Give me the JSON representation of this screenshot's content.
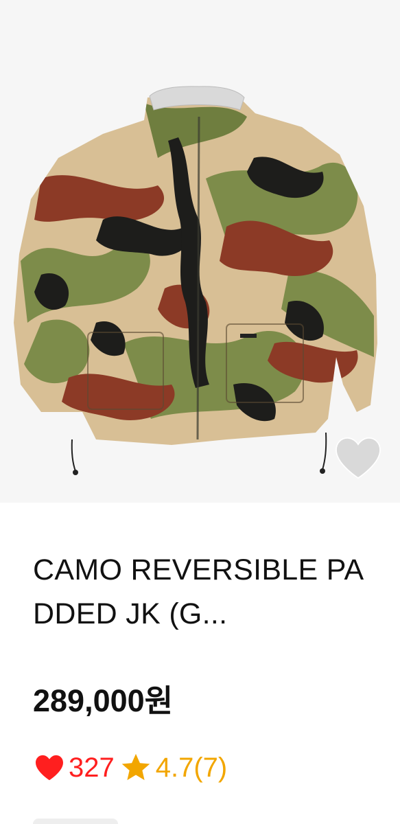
{
  "product": {
    "title": "CAMO REVERSIBLE PADDED JK (G...",
    "price": "289,000원",
    "likes": "327",
    "rating": "4.7(7)",
    "image_subject": "camouflage-puffer-jacket"
  },
  "icons": {
    "wish": "heart-outline-icon",
    "likes": "heart-filled-icon",
    "rating": "star-filled-icon"
  },
  "colors": {
    "like_red": "#ff1f1f",
    "rating_gold": "#f2a600",
    "text": "#111111"
  }
}
